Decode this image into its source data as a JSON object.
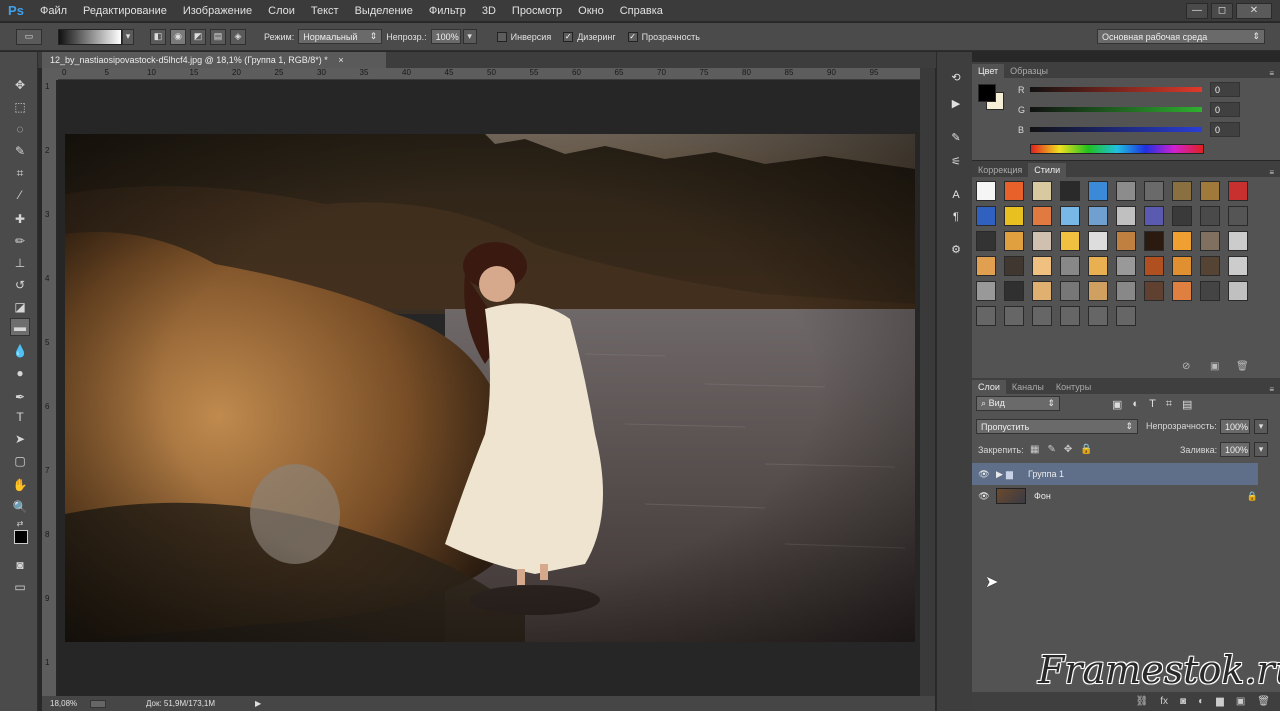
{
  "app": {
    "logo": "Ps"
  },
  "menu": [
    "Файл",
    "Редактирование",
    "Изображение",
    "Слои",
    "Текст",
    "Выделение",
    "Фильтр",
    "3D",
    "Просмотр",
    "Окно",
    "Справка"
  ],
  "window_controls": {
    "minimize": "—",
    "restore": "◻",
    "close": "✕"
  },
  "options": {
    "mode_label": "Режим:",
    "mode_value": "Нормальный",
    "opacity_label": "Непрозр.:",
    "opacity_value": "100%",
    "inverse_label": "Инверсия",
    "dither_label": "Дизеринг",
    "transparency_label": "Прозрачность",
    "workspace": "Основная рабочая среда"
  },
  "document": {
    "tab_title": "12_by_nastiaosipovastock-d5lhcf4.jpg @ 18,1% (Группа 1, RGB/8*) *",
    "ruler_h": [
      "0",
      "5",
      "10",
      "15",
      "20",
      "25",
      "30",
      "35",
      "40",
      "45",
      "50",
      "55",
      "60",
      "65",
      "70",
      "75",
      "80",
      "85",
      "90",
      "95"
    ],
    "ruler_v": [
      "1",
      "2",
      "3",
      "4",
      "5",
      "6",
      "7",
      "8",
      "9",
      "1"
    ],
    "zoom": "18,08%",
    "doc_size": "Док: 51,9M/173,1M"
  },
  "color_panel": {
    "tabs": [
      "Цвет",
      "Образцы"
    ],
    "channels": [
      {
        "label": "R",
        "value": "0",
        "color": "#e03a2a"
      },
      {
        "label": "G",
        "value": "0",
        "color": "#2fb030"
      },
      {
        "label": "B",
        "value": "0",
        "color": "#2a3ed8"
      }
    ]
  },
  "styles_panel": {
    "tabs": [
      "Коррекция",
      "Стили"
    ],
    "count": 56
  },
  "layers_panel": {
    "tabs": [
      "Слои",
      "Каналы",
      "Контуры"
    ],
    "filter_label": "Вид",
    "blend_mode": "Пропустить",
    "opacity_label": "Непрозрачность:",
    "opacity_value": "100%",
    "lock_label": "Закрепить:",
    "fill_label": "Заливка:",
    "fill_value": "100%",
    "layers": [
      {
        "name": "Группа 1",
        "type": "group",
        "selected": true
      },
      {
        "name": "Фон",
        "type": "image",
        "selected": false
      }
    ],
    "footer_icons": [
      "link-icon",
      "fx-icon",
      "mask-icon",
      "adjustment-icon",
      "folder-icon",
      "new-layer-icon",
      "trash-icon"
    ]
  },
  "watermark": "Framestok.ru"
}
